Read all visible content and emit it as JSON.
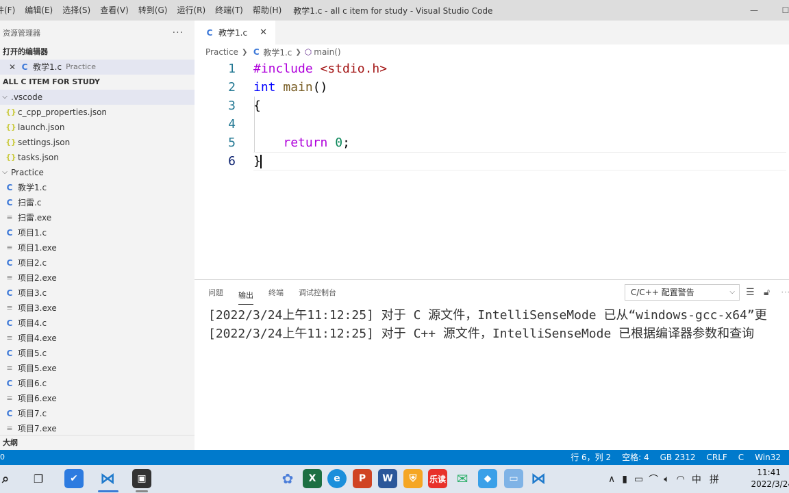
{
  "window": {
    "menus": [
      "件(F)",
      "编辑(E)",
      "选择(S)",
      "查看(V)",
      "转到(G)",
      "运行(R)",
      "终端(T)",
      "帮助(H)"
    ],
    "title": "教学1.c - all c item for study - Visual Studio Code",
    "minimize": "—",
    "maximize": "☐"
  },
  "sidebar": {
    "header": "资源管理器",
    "more": "···",
    "open_editors_title": "打开的编辑器",
    "open_editor": {
      "name": "教学1.c",
      "folder": "Practice"
    },
    "workspace_title": "ALL C ITEM FOR STUDY",
    "vscode_folder": ".vscode",
    "vscode_files": [
      "c_cpp_properties.json",
      "launch.json",
      "settings.json",
      "tasks.json"
    ],
    "practice_folder": "Practice",
    "practice_files": [
      {
        "name": "教学1.c",
        "type": "c"
      },
      {
        "name": "扫雷.c",
        "type": "c"
      },
      {
        "name": "扫雷.exe",
        "type": "exe"
      },
      {
        "name": "项目1.c",
        "type": "c"
      },
      {
        "name": "项目1.exe",
        "type": "exe"
      },
      {
        "name": "项目2.c",
        "type": "c"
      },
      {
        "name": "项目2.exe",
        "type": "exe"
      },
      {
        "name": "项目3.c",
        "type": "c"
      },
      {
        "name": "项目3.exe",
        "type": "exe"
      },
      {
        "name": "项目4.c",
        "type": "c"
      },
      {
        "name": "项目4.exe",
        "type": "exe"
      },
      {
        "name": "项目5.c",
        "type": "c"
      },
      {
        "name": "项目5.exe",
        "type": "exe"
      },
      {
        "name": "项目6.c",
        "type": "c"
      },
      {
        "name": "项目6.exe",
        "type": "exe"
      },
      {
        "name": "项目7.c",
        "type": "c"
      },
      {
        "name": "项目7.exe",
        "type": "exe"
      }
    ],
    "outline_title": "大纲"
  },
  "editor": {
    "tab_label": "教学1.c",
    "tab_icon": "C",
    "breadcrumb": {
      "folder": "Practice",
      "file": "教学1.c",
      "symbol": "main()"
    },
    "line_numbers": [
      "1",
      "2",
      "3",
      "4",
      "5",
      "6"
    ],
    "code": {
      "l1_pre": "#include",
      "l1_hdr": "<stdio.h>",
      "l2_type": "int",
      "l2_fn": "main",
      "l2_rest": "()",
      "l3": "{",
      "l5_kw": "return",
      "l5_num": "0",
      "l5_end": ";",
      "l6": "}"
    }
  },
  "panel": {
    "tabs": [
      "问题",
      "输出",
      "终端",
      "调试控制台"
    ],
    "active_tab": "输出",
    "channel": "C/C++ 配置警告",
    "lines": [
      "[2022/3/24上午11:12:25] 对于 C 源文件，IntelliSenseMode 已从“windows-gcc-x64”更",
      "[2022/3/24上午11:12:25] 对于 C++ 源文件，IntelliSenseMode 已根据编译器参数和查询"
    ]
  },
  "statusbar": {
    "left": "0",
    "items": [
      "行 6，列 2",
      "空格: 4",
      "GB 2312",
      "CRLF",
      "C",
      "Win32"
    ]
  },
  "taskbar": {
    "tray_ime": "中",
    "tray_ime2": "拼",
    "time": "11:41",
    "date": "2022/3/24",
    "app_labels": {
      "leread": "乐读"
    }
  },
  "colors": {
    "accent": "#007acc",
    "keyword_pre": "#af00db",
    "string": "#a31515",
    "type": "#0000ff",
    "function": "#795e26",
    "number": "#098658",
    "line_number": "#237893"
  }
}
